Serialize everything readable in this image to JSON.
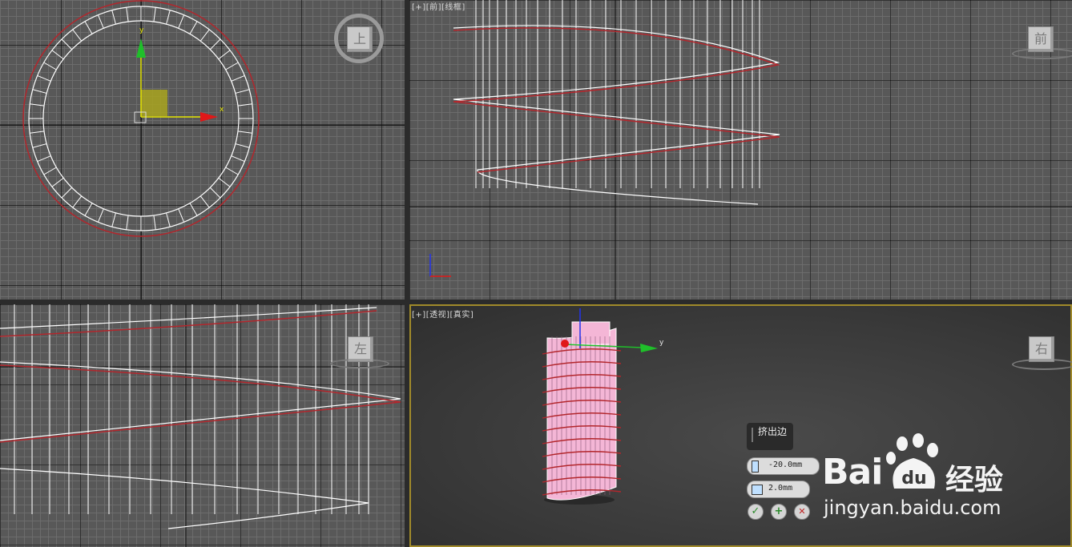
{
  "viewports": {
    "top_left": {
      "cube_face": "上"
    },
    "top_right": {
      "label": [
        "[+]",
        "[前]",
        "[线框]"
      ],
      "cube_face": "前"
    },
    "bottom_left": {
      "cube_face": "左"
    },
    "bottom_right": {
      "label": [
        "[+]",
        "[透视]",
        "[真实]"
      ],
      "cube_face": "右"
    }
  },
  "gizmo": {
    "x_label": "x",
    "y_label": "y"
  },
  "caddy": {
    "title": "挤出边",
    "height_value": "-20.0mm",
    "width_value": "2.0mm",
    "ok_symbol": "✓",
    "apply_symbol": "+",
    "cancel_symbol": "✕"
  },
  "watermark": {
    "brand": "Bai",
    "brand_suffix": "经验",
    "url": "jingyan.baidu.com",
    "paw_text": "du"
  },
  "colors": {
    "grid_bg": "#585858",
    "spline_red": "#b3262c",
    "wire_white": "#ffffff",
    "mesh_pink": "#f4b6d6",
    "active_border": "#a08a2a"
  }
}
